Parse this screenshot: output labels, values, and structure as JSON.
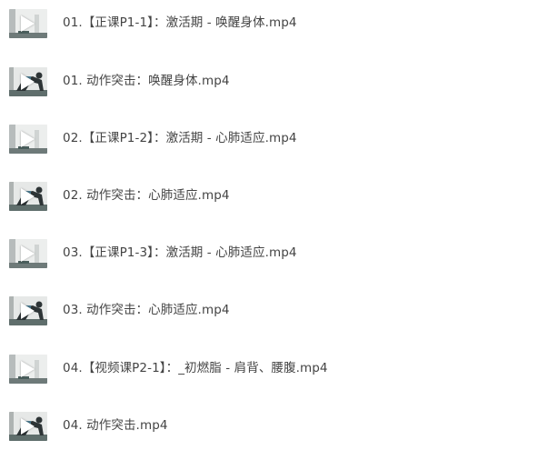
{
  "files": [
    {
      "name": "01.【正课P1-1】：激活期 - 唤醒身体.mp4",
      "thumb": "studio-icon"
    },
    {
      "name": "01. 动作突击：唤醒身体.mp4",
      "thumb": "exercise-icon"
    },
    {
      "name": "02.【正课P1-2】：激活期 - 心肺适应.mp4",
      "thumb": "studio-icon"
    },
    {
      "name": "02. 动作突击：心肺适应.mp4",
      "thumb": "exercise-icon"
    },
    {
      "name": "03.【正课P1-3】：激活期 - 心肺适应.mp4",
      "thumb": "studio-icon"
    },
    {
      "name": "03. 动作突击：心肺适应.mp4",
      "thumb": "exercise-icon"
    },
    {
      "name": "04.【视频课P2-1】：_初燃脂 - 肩背、腰腹.mp4",
      "thumb": "studio-icon"
    },
    {
      "name": "04. 动作突击.mp4",
      "thumb": "exercise-icon"
    }
  ],
  "colors": {
    "text": "#444444",
    "play": "#ffffff"
  }
}
